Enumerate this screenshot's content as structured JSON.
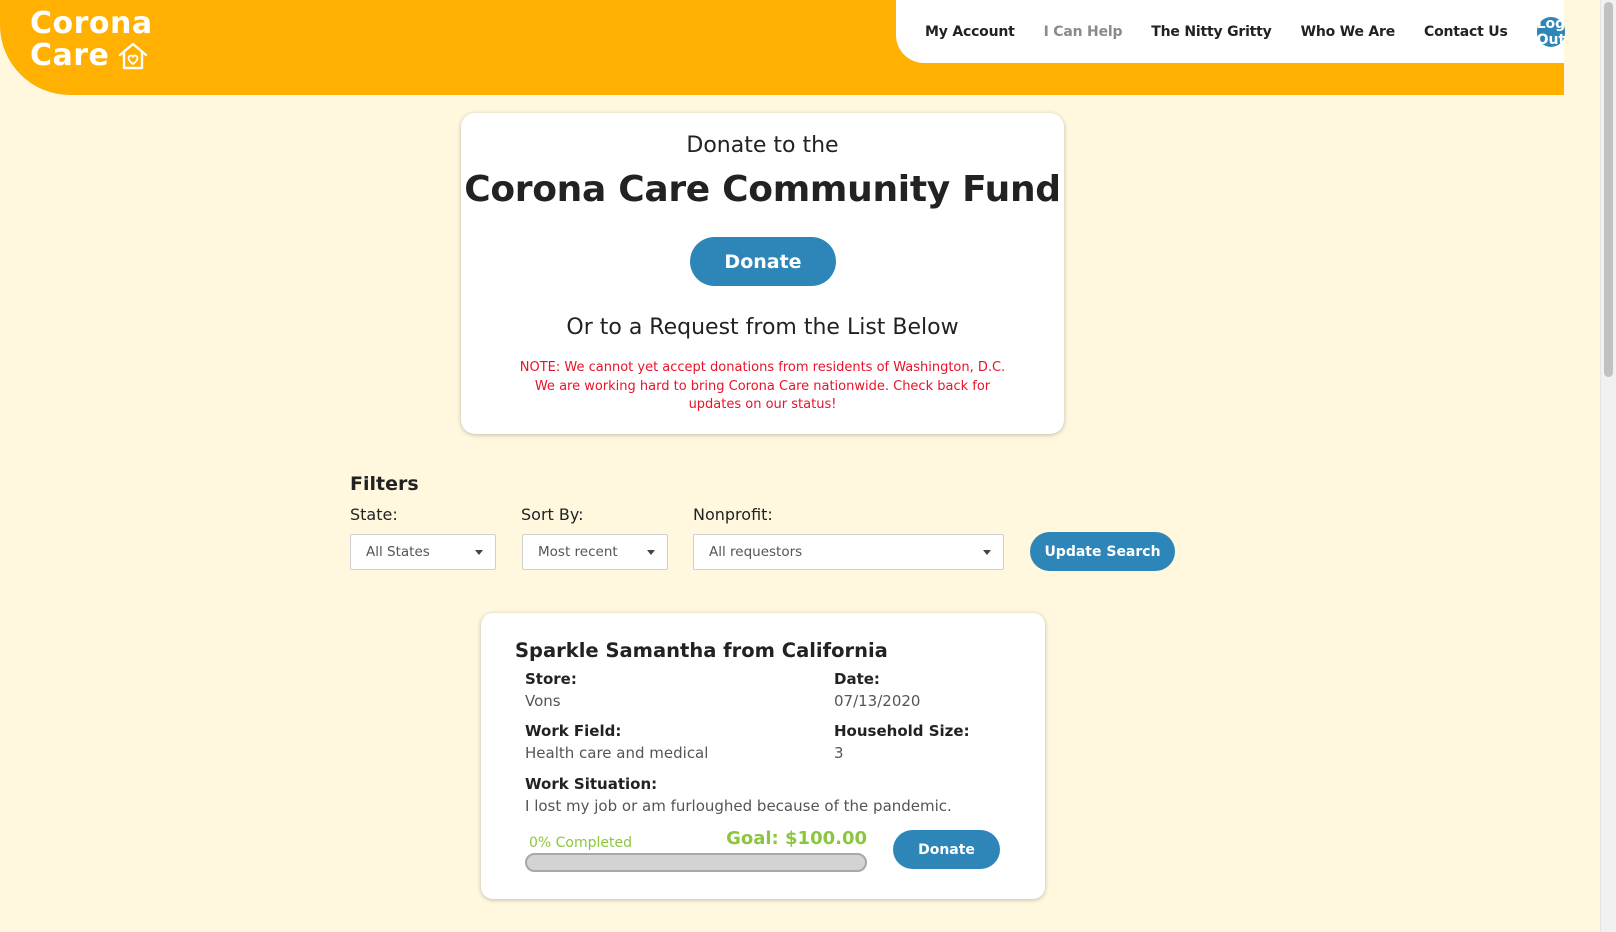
{
  "brand": {
    "line1": "Corona",
    "line2": "Care",
    "logo_icon": "house-heart-icon"
  },
  "nav": {
    "items": [
      {
        "label": "My Account"
      },
      {
        "label": "I Can Help"
      },
      {
        "label": "The Nitty Gritty"
      },
      {
        "label": "Who We Are"
      },
      {
        "label": "Contact Us"
      }
    ],
    "logout_label": "Log Out"
  },
  "fund": {
    "subtitle": "Donate to the",
    "title": "Corona Care Community Fund",
    "donate_label": "Donate",
    "or_text": "Or to a Request from the List Below",
    "note": "NOTE: We cannot yet accept donations from residents of Washington, D.C. We are working hard to bring Corona Care nationwide. Check back for updates on our status!"
  },
  "filters": {
    "title": "Filters",
    "state": {
      "label": "State:",
      "value": "All States"
    },
    "sort": {
      "label": "Sort By:",
      "value": "Most recent"
    },
    "nonprofit": {
      "label": "Nonprofit:",
      "value": "All requestors"
    },
    "update_label": "Update Search"
  },
  "request": {
    "title": "Sparkle Samantha from California",
    "store_label": "Store:",
    "store_value": "Vons",
    "date_label": "Date:",
    "date_value": "07/13/2020",
    "work_field_label": "Work Field:",
    "work_field_value": "Health care and medical",
    "household_label": "Household Size:",
    "household_value": "3",
    "work_situation_label": "Work Situation:",
    "work_situation_value": "I lost my job or am furloughed because of the pandemic.",
    "progress_text": "0% Completed",
    "progress_fraction": 0,
    "goal_text": "Goal: $100.00",
    "donate_label": "Donate"
  },
  "colors": {
    "brand_orange": "#ffb000",
    "accent_blue": "#2e86b8",
    "page_bg": "#fff8df",
    "note_red": "#e8132a",
    "progress_green": "#8cc63f"
  }
}
